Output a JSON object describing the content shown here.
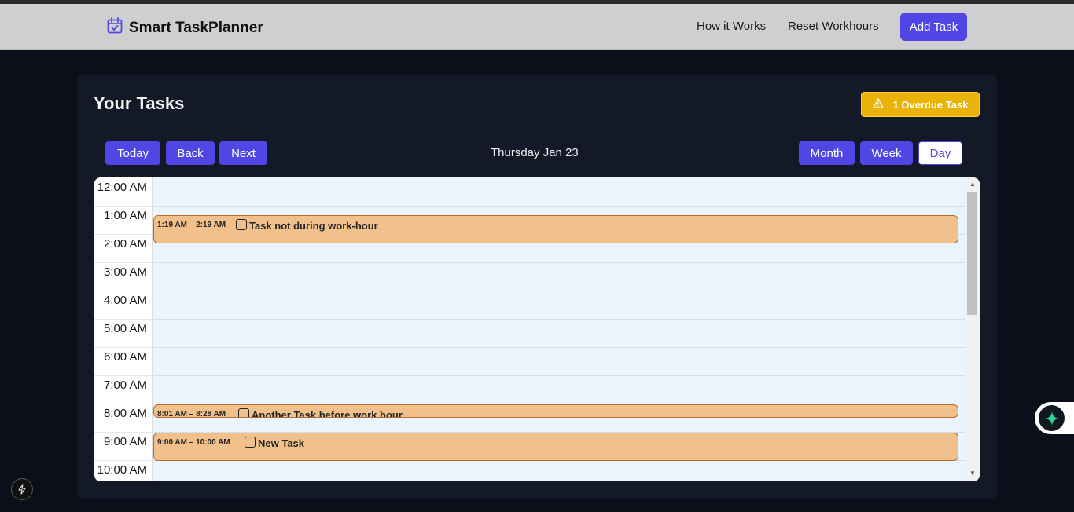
{
  "brand": {
    "title": "Smart TaskPlanner",
    "icon": "calendar-check-icon",
    "accent": "#4f46e5"
  },
  "nav": {
    "how_it_works": "How it Works",
    "reset_workhours": "Reset Workhours",
    "add_task": "Add Task"
  },
  "main": {
    "title": "Your Tasks",
    "overdue_badge": "1 Overdue Task",
    "overdue_color": "#eab308",
    "toolbar": {
      "today": "Today",
      "back": "Back",
      "next": "Next",
      "date": "Thursday Jan 23",
      "month": "Month",
      "week": "Week",
      "day": "Day",
      "active_view": "Day"
    }
  },
  "calendar": {
    "time_slots": [
      "12:00 AM",
      "1:00 AM",
      "2:00 AM",
      "3:00 AM",
      "4:00 AM",
      "5:00 AM",
      "6:00 AM",
      "7:00 AM",
      "8:00 AM",
      "9:00 AM",
      "10:00 AM"
    ],
    "events": [
      {
        "time": "1:19 AM – 2:19 AM",
        "title": "Task not during work-hour",
        "color": "#f2c18b"
      },
      {
        "time": "8:01 AM – 8:28 AM",
        "title": "Another Task before work hour",
        "color": "#f2c18b"
      },
      {
        "time": "9:00 AM – 10:00 AM",
        "title": "New Task",
        "color": "#f2c18b"
      }
    ]
  }
}
